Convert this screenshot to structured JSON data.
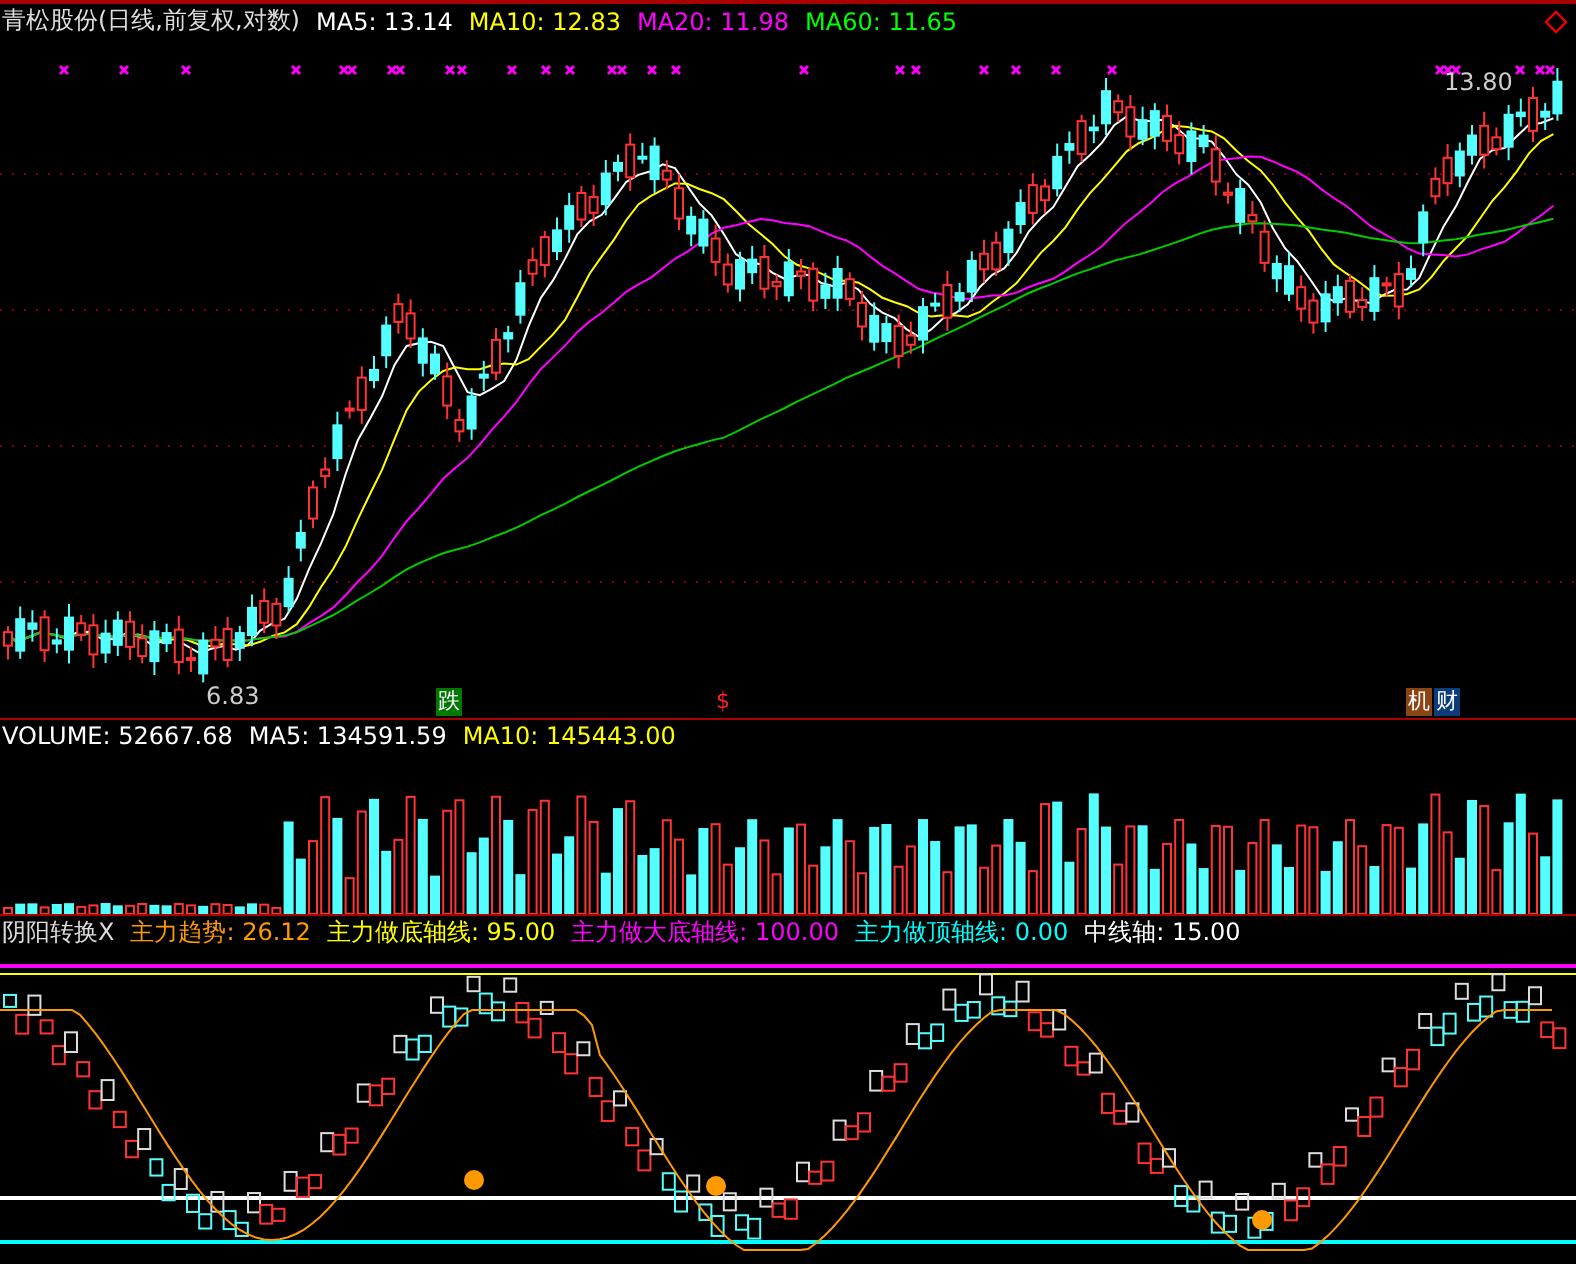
{
  "main": {
    "title": "青松股份(日线,前复权,对数)",
    "indicators": [
      {
        "label": "MA5: 13.14",
        "color": "#ffffff"
      },
      {
        "label": "MA10: 12.83",
        "color": "#ffff00"
      },
      {
        "label": "MA20: 11.98",
        "color": "#ff00ff"
      },
      {
        "label": "MA60: 11.65",
        "color": "#00ff00"
      }
    ],
    "high_label": "13.80",
    "low_label": "6.83",
    "markers": [
      {
        "text": "跌",
        "color": "#007700"
      },
      {
        "text": "$",
        "color": "#000000"
      },
      {
        "text": "机",
        "color": "#8b4513"
      },
      {
        "text": "财",
        "color": "#0d3c7a"
      }
    ]
  },
  "volume": {
    "indicators": [
      {
        "label": "VOLUME: 52667.68",
        "color": "#ffffff"
      },
      {
        "label": "MA5: 134591.59",
        "color": "#ffffff"
      },
      {
        "label": "MA10: 145443.00",
        "color": "#ffff00"
      }
    ]
  },
  "oscillator": {
    "title": "阴阳转换X",
    "indicators": [
      {
        "label": "主力趋势: 26.12",
        "color": "#ff9900"
      },
      {
        "label": "主力做底轴线: 95.00",
        "color": "#ffff00"
      },
      {
        "label": "主力做大底轴线: 100.00",
        "color": "#ff00ff"
      },
      {
        "label": "主力做顶轴线: 0.00",
        "color": "#00ffff"
      },
      {
        "label": "中线轴: 15.00",
        "color": "#ffffff"
      }
    ]
  }
}
